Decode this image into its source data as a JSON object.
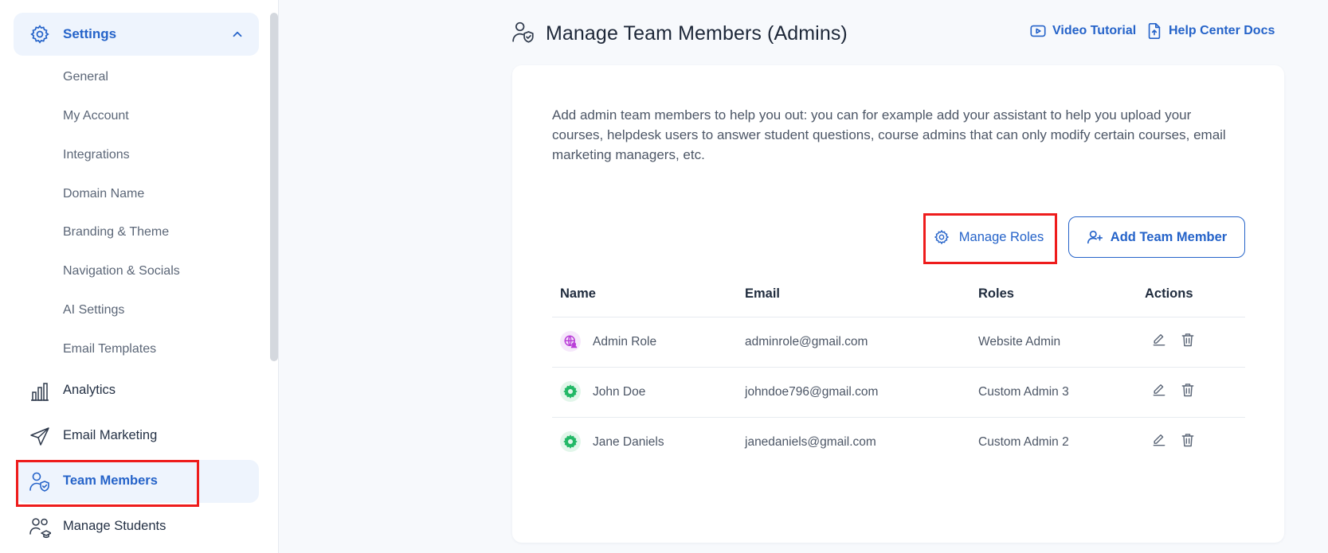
{
  "sidebar": {
    "settings_label": "Settings",
    "sub_items": [
      "General",
      "My Account",
      "Integrations",
      "Domain Name",
      "Branding & Theme",
      "Navigation & Socials",
      "AI Settings",
      "Email Templates"
    ],
    "nav": {
      "analytics": "Analytics",
      "email_marketing": "Email Marketing",
      "team_members": "Team Members",
      "manage_students": "Manage Students"
    }
  },
  "header": {
    "title": "Manage Team Members (Admins)",
    "video_tutorial": "Video Tutorial",
    "help_center": "Help Center Docs"
  },
  "card": {
    "intro": "Add admin team members to help you out: you can for example add your assistant to help you upload your courses, helpdesk users to answer student questions, course admins that can only modify certain courses, email marketing managers, etc.",
    "manage_roles": "Manage Roles",
    "add_member": "Add Team Member"
  },
  "table": {
    "headers": {
      "name": "Name",
      "email": "Email",
      "roles": "Roles",
      "actions": "Actions"
    },
    "rows": [
      {
        "name": "Admin Role",
        "email": "adminrole@gmail.com",
        "role": "Website Admin",
        "avatar": "globe-user-icon"
      },
      {
        "name": "John Doe",
        "email": "johndoe796@gmail.com",
        "role": "Custom Admin 3",
        "avatar": "gear-icon"
      },
      {
        "name": "Jane Daniels",
        "email": "janedaniels@gmail.com",
        "role": "Custom Admin 2",
        "avatar": "gear-icon"
      }
    ]
  },
  "colors": {
    "accent": "#2563c9",
    "highlight": "#ee1c1c",
    "avatar_purple": "#b93fd8",
    "avatar_green": "#22b866"
  }
}
